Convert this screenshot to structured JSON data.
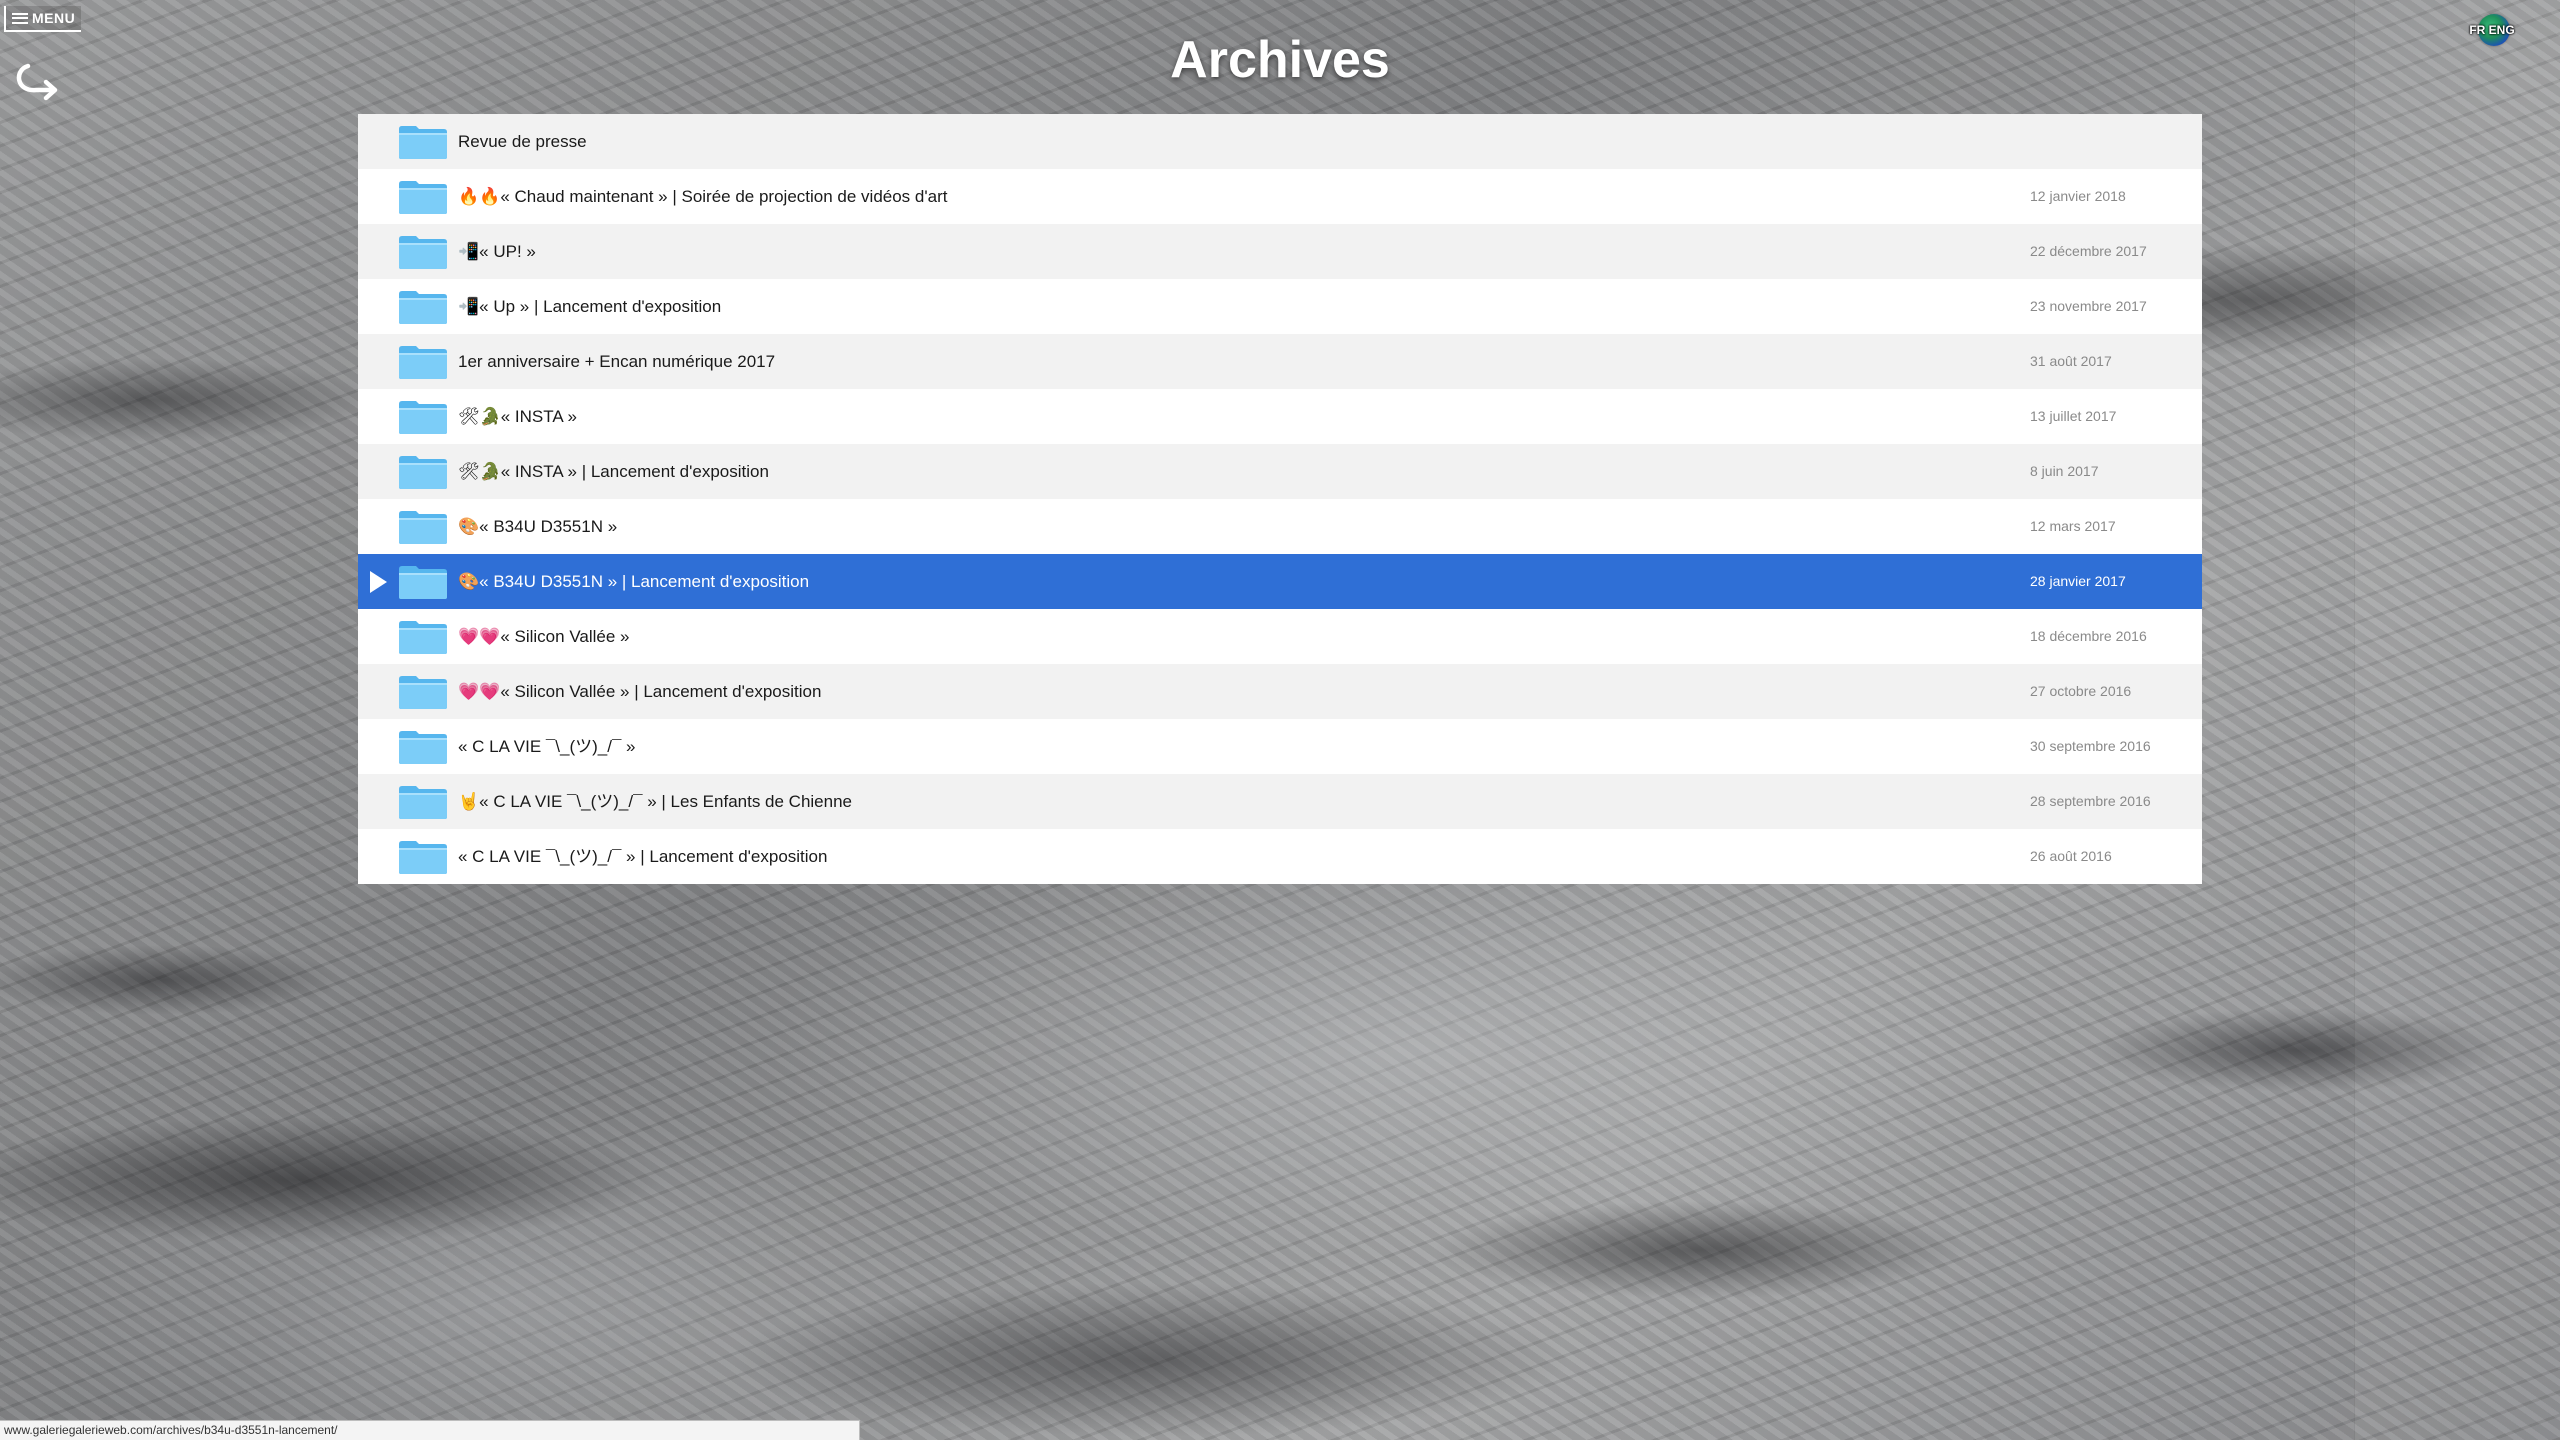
{
  "header": {
    "menu_label": "MENU",
    "page_title": "Archives",
    "lang_label": "FR ENG"
  },
  "colors": {
    "selection": "#2f6fd6",
    "folder": "#6cc4f4",
    "date_text": "#8a8a8a"
  },
  "icons": {
    "menu": "hamburger-icon",
    "back": "return-arrow-icon",
    "lang": "globe-icon",
    "folder": "folder-icon",
    "play": "play-arrow-icon"
  },
  "archives": {
    "items": [
      {
        "title": "Revue de presse",
        "date": ""
      },
      {
        "title": "🔥🔥« Chaud maintenant » | Soirée de projection de vidéos d'art",
        "date": "12 janvier 2018"
      },
      {
        "title": "📲« UP! »",
        "date": "22 décembre 2017"
      },
      {
        "title": "📲« Up » | Lancement d'exposition",
        "date": "23 novembre 2017"
      },
      {
        "title": "1er anniversaire + Encan numérique 2017",
        "date": "31 août 2017"
      },
      {
        "title": "🛠🐊« INSTA »",
        "date": "13 juillet 2017"
      },
      {
        "title": "🛠🐊« INSTA » | Lancement d'exposition",
        "date": "8 juin 2017"
      },
      {
        "title": "🎨« B34U D3551N »",
        "date": "12 mars 2017"
      },
      {
        "title": "🎨« B34U D3551N » | Lancement d'exposition",
        "date": "28 janvier 2017",
        "selected": true
      },
      {
        "title": "💗💗« Silicon Vallée »",
        "date": "18 décembre 2016"
      },
      {
        "title": "💗💗« Silicon Vallée » | Lancement d'exposition",
        "date": "27 octobre 2016"
      },
      {
        "title": "« C LA VIE ¯\\_(ツ)_/¯ »",
        "date": "30 septembre 2016"
      },
      {
        "title": "🤘« C LA VIE ¯\\_(ツ)_/¯ » | Les Enfants de Chienne",
        "date": "28 septembre 2016"
      },
      {
        "title": "« C LA VIE ¯\\_(ツ)_/¯ » | Lancement d'exposition",
        "date": "26 août 2016"
      }
    ]
  },
  "status_bar": {
    "url": "www.galeriegalerieweb.com/archives/b34u-d3551n-lancement/"
  }
}
